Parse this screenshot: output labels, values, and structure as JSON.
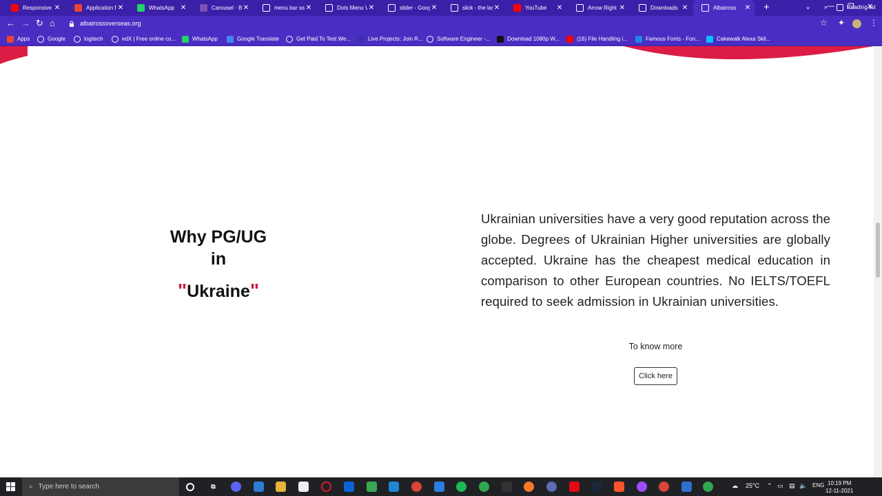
{
  "tabs": [
    {
      "title": "Responsive Sl",
      "icon": "youtube-icon",
      "color": "#ff0000"
    },
    {
      "title": "Application fo",
      "icon": "gmail-icon",
      "color": "#ea4335"
    },
    {
      "title": "WhatsApp",
      "icon": "whatsapp-icon",
      "color": "#25d366"
    },
    {
      "title": "Carousel · Boo",
      "icon": "bootstrap-icon",
      "color": "#7952b3"
    },
    {
      "title": "menu bar ssw",
      "icon": "google-icon",
      "color": "#ffffff"
    },
    {
      "title": "Dots Menu Ve",
      "icon": "dots-menu-icon",
      "color": "#ffffff"
    },
    {
      "title": "slider - Googl",
      "icon": "google-icon",
      "color": "#ffffff"
    },
    {
      "title": "slick - the las",
      "icon": "globe-icon",
      "color": "#ffffff"
    },
    {
      "title": "YouTube",
      "icon": "youtube-icon",
      "color": "#ff0000"
    },
    {
      "title": "Arrow Right I",
      "icon": "flag-icon",
      "color": "#ffffff"
    },
    {
      "title": "Downloads",
      "icon": "download-icon",
      "color": "#ffffff"
    },
    {
      "title": "Albatross",
      "icon": "globe-icon",
      "color": "#ffffff",
      "active": true
    }
  ],
  "toolbar": {
    "url": "albatrossoverseas.org"
  },
  "bookmarks": [
    {
      "label": "Apps",
      "icon": "apps-icon",
      "color": "#ea4335"
    },
    {
      "label": "Google",
      "icon": "google-icon",
      "color": "#ffffff"
    },
    {
      "label": "logitech",
      "icon": "logitech-icon",
      "color": "#ffffff"
    },
    {
      "label": "edX | Free online co...",
      "icon": "edx-icon",
      "color": "#ffffff"
    },
    {
      "label": "WhatsApp",
      "icon": "whatsapp-icon",
      "color": "#25d366"
    },
    {
      "label": "Google Translate",
      "icon": "translate-icon",
      "color": "#4285f4"
    },
    {
      "label": "Get Paid To Test We...",
      "icon": "test-icon",
      "color": "#ffffff"
    },
    {
      "label": "Live Projects: Join R...",
      "icon": "live-projects-icon",
      "color": "#3b2fb0"
    },
    {
      "label": "Software Engineer -...",
      "icon": "google-icon",
      "color": "#ffffff"
    },
    {
      "label": "Download 1080p W...",
      "icon": "download-1080p-icon",
      "color": "#111111"
    },
    {
      "label": "(16) File Handling i...",
      "icon": "youtube-icon",
      "color": "#ff0000"
    },
    {
      "label": "Famous Fonts - Fon...",
      "icon": "fonts-icon",
      "color": "#1e88e5"
    },
    {
      "label": "Cakewalk Alexa Skil...",
      "icon": "alexa-icon",
      "color": "#00c2ff"
    }
  ],
  "reading_list": "Reading list",
  "content": {
    "heading_line1": "Why PG/UG",
    "heading_line2": "in",
    "quote_open": "\"",
    "country": "Ukraine",
    "quote_close": "\"",
    "paragraph": "Ukrainian universities have a very good reputation across the globe. Degrees of Ukrainian Higher universities are globally accepted. Ukraine has the cheapest medical education in comparison to other European countries. No IELTS/TOEFL required to seek admission in Ukrainian universities.",
    "know_more": "To know more",
    "button": "Click here"
  },
  "taskbar": {
    "search_placeholder": "Type here to search",
    "weather": "25°C",
    "lang": "ENG",
    "time": "10:19 PM",
    "date": "12-11-2021"
  },
  "colors": {
    "tabbar": "#3c1fa8",
    "toolbar": "#4a2dc2",
    "accent": "#c8203f"
  }
}
